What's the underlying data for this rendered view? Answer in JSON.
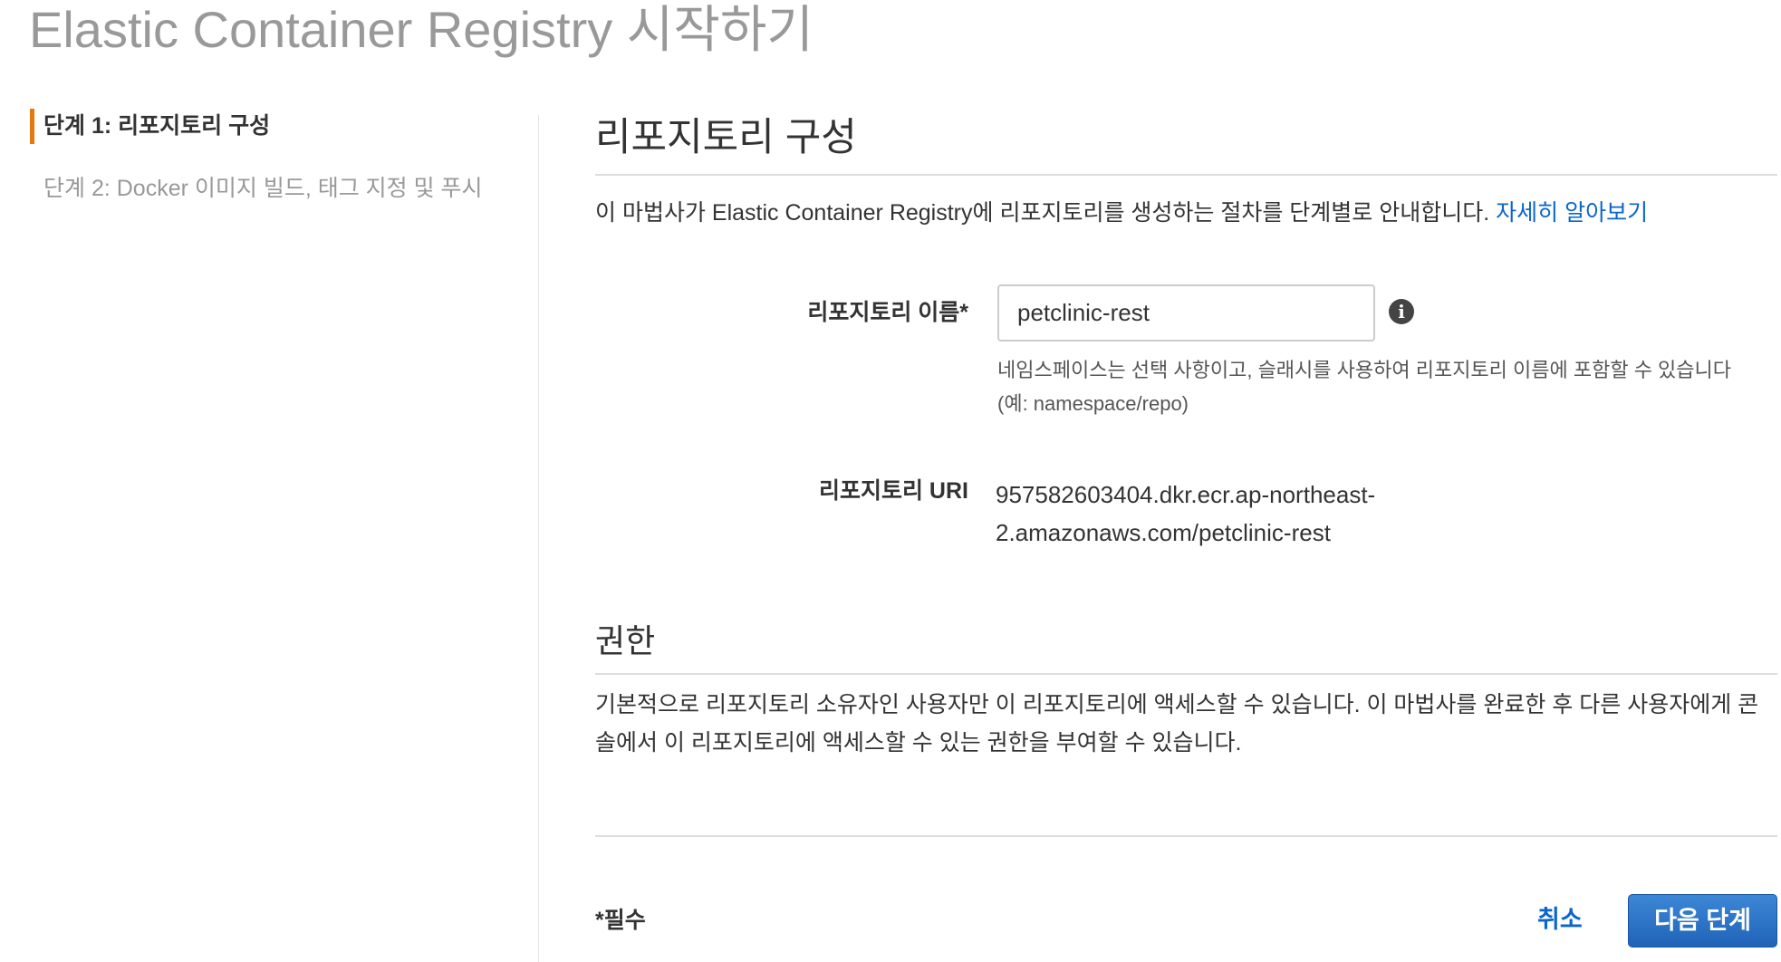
{
  "page": {
    "title": "Elastic Container Registry 시작하기"
  },
  "nav": {
    "steps": [
      {
        "label": "단계 1: 리포지토리 구성",
        "active": true
      },
      {
        "label": "단계 2: Docker 이미지 빌드, 태그 지정 및 푸시",
        "active": false
      }
    ]
  },
  "main": {
    "heading": "리포지토리 구성",
    "intro": "이 마법사가 Elastic Container Registry에 리포지토리를 생성하는 절차를 단계별로 안내합니다. ",
    "learn_more": "자세히 알아보기",
    "name_label": "리포지토리 이름*",
    "name_value": "petclinic-rest",
    "name_help": "네임스페이스는 선택 사항이고, 슬래시를 사용하여 리포지토리 이름에 포함할 수 있습니다(예: namespace/repo)",
    "uri_label": "리포지토리 URI",
    "uri_value": "957582603404.dkr.ecr.ap-northeast-2.amazonaws.com/petclinic-rest",
    "permissions_heading": "권한",
    "permissions_text": "기본적으로 리포지토리 소유자인 사용자만 이 리포지토리에 액세스할 수 있습니다. 이 마법사를 완료한 후 다른 사용자에게 콘솔에서 이 리포지토리에 액세스할 수 있는 권한을 부여할 수 있습니다."
  },
  "footer": {
    "required": "*필수",
    "cancel": "취소",
    "next": "다음 단계"
  },
  "colors": {
    "accent": "#e47911",
    "link": "#0b66c9",
    "button": "#2a70c4"
  }
}
